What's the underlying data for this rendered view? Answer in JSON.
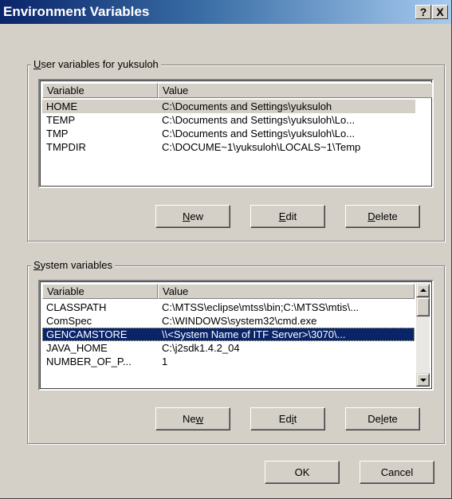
{
  "window": {
    "title": "Environment Variables",
    "help_label": "?",
    "close_label": "X"
  },
  "user_group": {
    "legend_accel": "U",
    "legend_rest": "ser variables for yuksuloh",
    "columns": [
      "Variable",
      "Value"
    ],
    "rows": [
      {
        "variable": "HOME",
        "value": "C:\\Documents and Settings\\yuksuloh"
      },
      {
        "variable": "TEMP",
        "value": "C:\\Documents and Settings\\yuksuloh\\Lo..."
      },
      {
        "variable": "TMP",
        "value": "C:\\Documents and Settings\\yuksuloh\\Lo..."
      },
      {
        "variable": "TMPDIR",
        "value": "C:\\DOCUME~1\\yuksuloh\\LOCALS~1\\Temp"
      }
    ],
    "buttons": {
      "new_accel": "N",
      "new_rest": "ew",
      "edit_accel": "E",
      "edit_rest": "dit",
      "delete_accel": "D",
      "delete_rest": "elete"
    }
  },
  "system_group": {
    "legend_accel": "S",
    "legend_rest": "ystem variables",
    "columns": [
      "Variable",
      "Value"
    ],
    "rows": [
      {
        "variable": "CLASSPATH",
        "value": "C:\\MTSS\\eclipse\\mtss\\bin;C:\\MTSS\\mtis\\..."
      },
      {
        "variable": "ComSpec",
        "value": "C:\\WINDOWS\\system32\\cmd.exe"
      },
      {
        "variable": "GENCAMSTORE",
        "value": "\\\\<System Name of ITF Server>\\3070\\..."
      },
      {
        "variable": "JAVA_HOME",
        "value": "C:\\j2sdk1.4.2_04"
      },
      {
        "variable": "NUMBER_OF_P...",
        "value": "1"
      }
    ],
    "buttons": {
      "new_pre": "Ne",
      "new_accel": "w",
      "new_post": "",
      "edit_pre": "Ed",
      "edit_accel": "i",
      "edit_post": "t",
      "delete_pre": "De",
      "delete_accel": "l",
      "delete_post": "ete"
    }
  },
  "footer": {
    "ok_label": "OK",
    "cancel_label": "Cancel"
  },
  "colors": {
    "selection": "#0a246a",
    "face": "#d4d0c8"
  }
}
